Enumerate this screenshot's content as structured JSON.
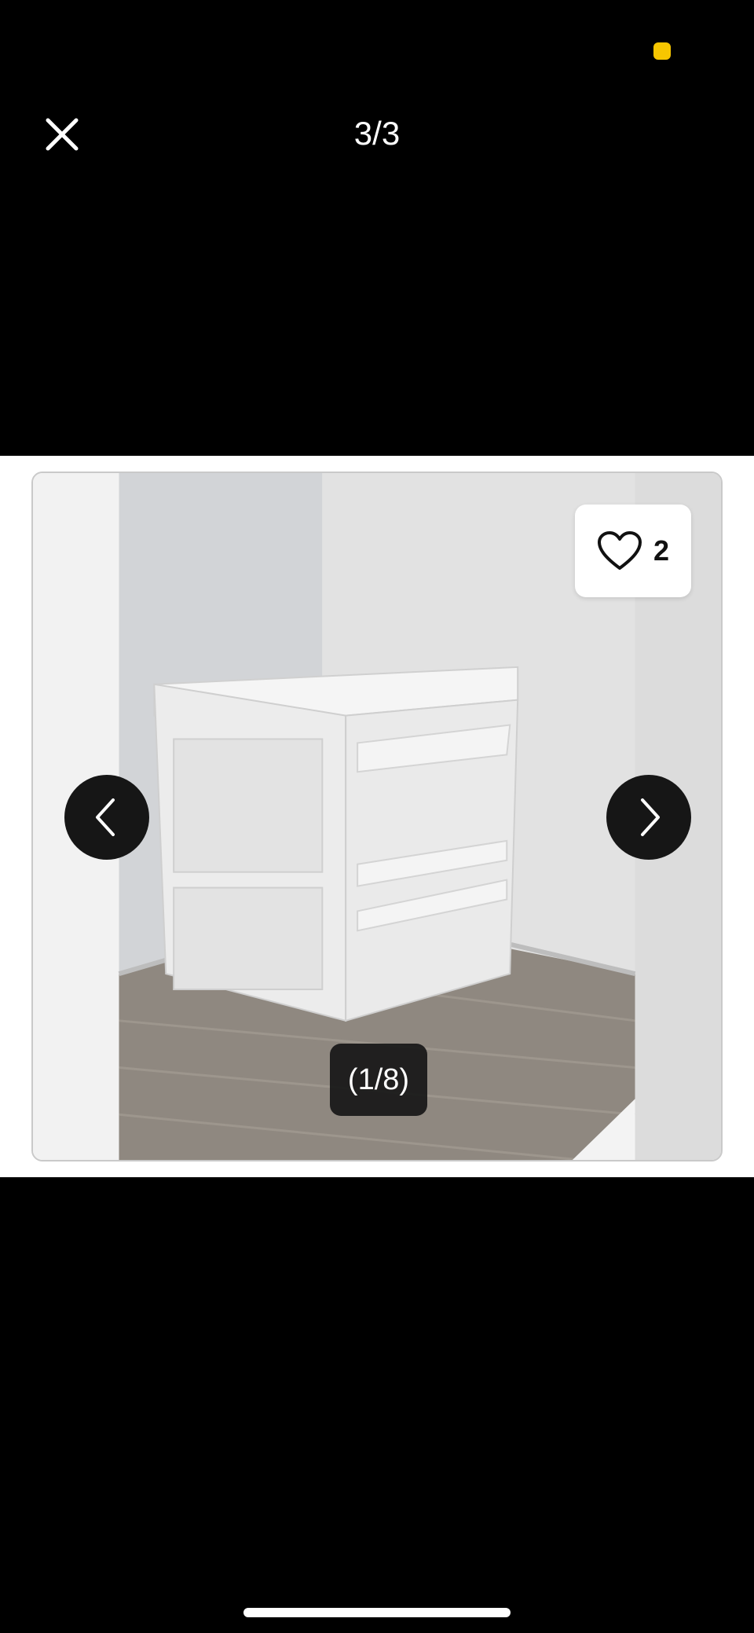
{
  "header": {
    "counter": "3/3",
    "close_icon": "close-icon"
  },
  "colors": {
    "background": "#000000",
    "status_dot": "#f7c600",
    "nav_button": "#161616"
  },
  "listing": {
    "favorites_icon": "heart-outline-icon",
    "favorites_count": "2",
    "photo_index": "(1/8)",
    "prev_icon": "chevron-left-icon",
    "next_icon": "chevron-right-icon"
  }
}
